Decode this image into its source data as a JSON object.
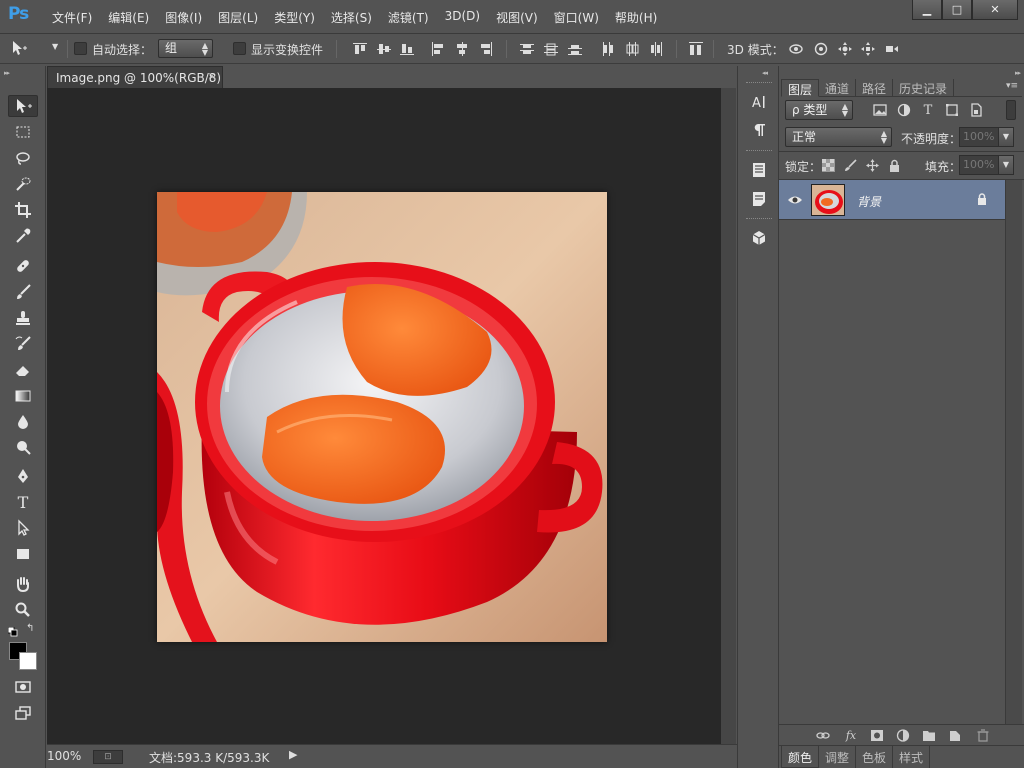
{
  "app": {
    "logo": "Ps"
  },
  "menu": [
    "文件(F)",
    "编辑(E)",
    "图像(I)",
    "图层(L)",
    "类型(Y)",
    "选择(S)",
    "滤镜(T)",
    "3D(D)",
    "视图(V)",
    "窗口(W)",
    "帮助(H)"
  ],
  "window_controls": {
    "minimize": "▁",
    "maximize": "□",
    "close": "✕"
  },
  "options_bar": {
    "auto_select_label": "自动选择：",
    "auto_select_checked": false,
    "group_value": "组",
    "show_transform_label": "显示变换控件",
    "show_transform_checked": false,
    "mode_3d_label": "3D 模式："
  },
  "tools": [
    "move-tool",
    "marquee-tool",
    "lasso-tool",
    "quick-selection-tool",
    "crop-tool",
    "eyedropper-tool",
    "healing-brush-tool",
    "brush-tool",
    "clone-stamp-tool",
    "history-brush-tool",
    "eraser-tool",
    "gradient-tool",
    "blur-tool",
    "dodge-tool",
    "pen-tool",
    "type-tool",
    "path-selection-tool",
    "rectangle-tool",
    "hand-tool",
    "zoom-tool"
  ],
  "active_tool": "move-tool",
  "colors": {
    "foreground": "#000000",
    "background": "#ffffff",
    "selected_layer": "#6b7d9b",
    "ps_blue": "#3f9ee8"
  },
  "document": {
    "tab_title": "Image.png @ 100%(RGB/8)",
    "tab_close": "×",
    "zoom": "100%",
    "doc_info": "文档:593.3 K/593.3K",
    "status_arrow": "▶"
  },
  "layers_panel": {
    "tabs": [
      "图层",
      "通道",
      "路径",
      "历史记录"
    ],
    "active_tab": "图层",
    "filter_kind": "ρ 类型",
    "blend_mode": "正常",
    "opacity_label": "不透明度：",
    "opacity_value": "100%",
    "lock_label": "锁定：",
    "fill_label": "填充：",
    "fill_value": "100%",
    "layers": [
      {
        "name": "背景",
        "visible": true,
        "locked": true,
        "selected": true
      }
    ]
  },
  "bottom_tabs": [
    "颜色",
    "调整",
    "色板",
    "样式"
  ],
  "bottom_active_tab": "颜色"
}
